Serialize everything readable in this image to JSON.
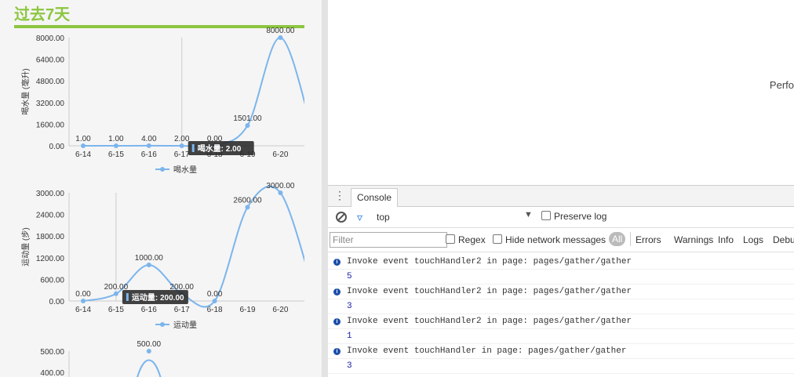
{
  "page": {
    "title": "过去7天"
  },
  "chart_data": [
    {
      "type": "line",
      "categories": [
        "6-14",
        "6-15",
        "6-16",
        "6-17",
        "6-18",
        "6-19",
        "6-20"
      ],
      "series": [
        {
          "name": "喝水量",
          "values": [
            1,
            1,
            4,
            2,
            0,
            1501,
            8000
          ]
        }
      ],
      "data_labels": [
        "1.00",
        "1.00",
        "4.00",
        "2.00",
        "0.00",
        "1501.00",
        "8000.00"
      ],
      "ylabel": "喝水量 (毫升)",
      "yticks": [
        "8000.00",
        "6400.00",
        "4800.00",
        "3200.00",
        "1600.00",
        "0.00"
      ],
      "ylim": [
        0,
        8000
      ],
      "tooltip": "喝水量: 2.00",
      "color": "#7cb5ec"
    },
    {
      "type": "line",
      "categories": [
        "6-14",
        "6-15",
        "6-16",
        "6-17",
        "6-18",
        "6-19",
        "6-20"
      ],
      "series": [
        {
          "name": "运动量",
          "values": [
            0,
            200,
            1000,
            200,
            0,
            2600,
            3000
          ]
        }
      ],
      "data_labels": [
        "0.00",
        "200.00",
        "1000.00",
        "200.00",
        "0.00",
        "2600.00",
        "3000.00"
      ],
      "ylabel": "运动量 (步)",
      "yticks": [
        "3000.00",
        "2400.00",
        "1800.00",
        "1200.00",
        "600.00",
        "0.00"
      ],
      "ylim": [
        0,
        3000
      ],
      "tooltip": "运动量: 200.00",
      "color": "#7cb5ec"
    },
    {
      "type": "line",
      "series": [
        {
          "values": [
            500
          ]
        }
      ],
      "data_labels": [
        "500.00"
      ],
      "yticks": [
        "500.00",
        "400.00"
      ],
      "ylim": [
        0,
        500
      ],
      "color": "#7cb5ec"
    }
  ],
  "simulator": {
    "perf_text": "Perfo"
  },
  "devtools": {
    "tab": "Console",
    "context": "top",
    "preserve_log": "Preserve log",
    "filter_placeholder": "Filter",
    "regex": "Regex",
    "hide_network": "Hide network messages",
    "levels": {
      "all": "All",
      "errors": "Errors",
      "warnings": "Warnings",
      "info": "Info",
      "logs": "Logs",
      "debug": "Debu"
    },
    "logs": [
      {
        "msg": "Invoke event touchHandler2 in page: pages/gather/gather",
        "value": "5"
      },
      {
        "msg": "Invoke event touchHandler2 in page: pages/gather/gather",
        "value": "3"
      },
      {
        "msg": "Invoke event touchHandler2 in page: pages/gather/gather",
        "value": "1"
      },
      {
        "msg": "Invoke event touchHandler in page: pages/gather/gather",
        "value": "3"
      }
    ]
  }
}
